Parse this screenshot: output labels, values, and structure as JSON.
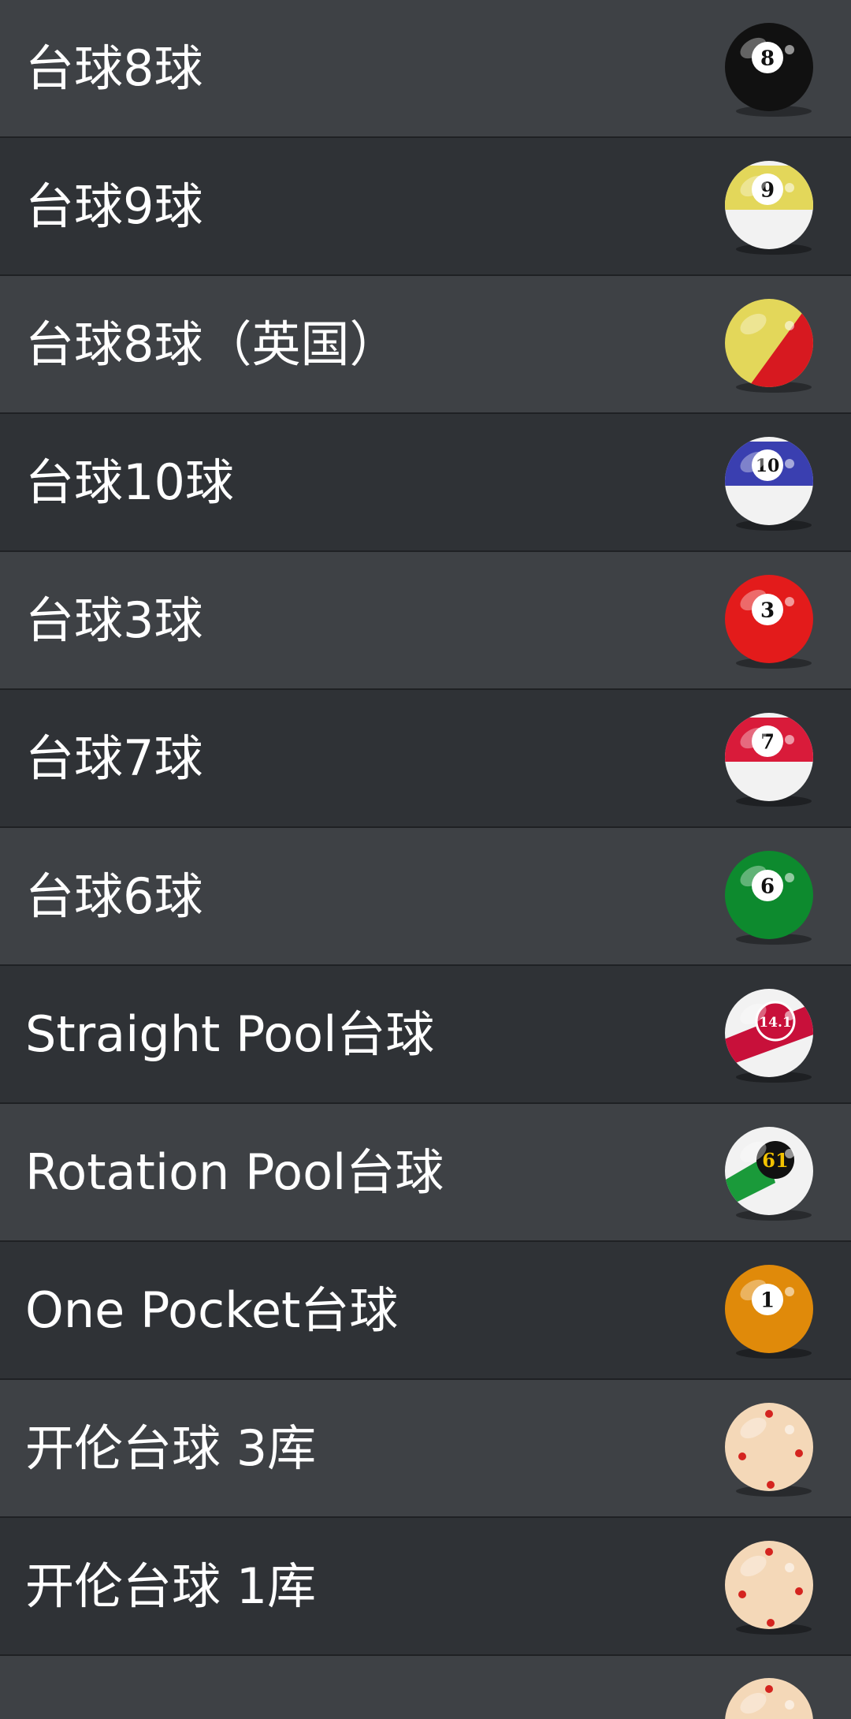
{
  "game_list": {
    "items": [
      {
        "label": "台球8球",
        "icon": "eight-ball-icon",
        "kind": "solid",
        "color": "#111111",
        "num": "8"
      },
      {
        "label": "台球9球",
        "icon": "nine-ball-icon",
        "kind": "stripe",
        "color": "#e3d75a",
        "num": "9"
      },
      {
        "label": "台球8球（英国）",
        "icon": "uk-eight-ball-icon",
        "kind": "split",
        "color": "#e3d75a",
        "color2": "#d71920",
        "num": ""
      },
      {
        "label": "台球10球",
        "icon": "ten-ball-icon",
        "kind": "stripe",
        "color": "#3a3fb0",
        "num": "10"
      },
      {
        "label": "台球3球",
        "icon": "three-ball-icon",
        "kind": "solid",
        "color": "#e31b1b",
        "num": "3"
      },
      {
        "label": "台球7球",
        "icon": "seven-ball-icon",
        "kind": "stripe",
        "color": "#d91b3a",
        "num": "7"
      },
      {
        "label": "台球6球",
        "icon": "six-ball-icon",
        "kind": "solid",
        "color": "#0d8a2e",
        "num": "6"
      },
      {
        "label": "Straight Pool台球",
        "icon": "straight-pool-ball-icon",
        "kind": "band",
        "color": "#c8103a",
        "num": "14.1"
      },
      {
        "label": "Rotation Pool台球",
        "icon": "rotation-pool-ball-icon",
        "kind": "rotation",
        "color": "#1a9a3a",
        "num": "61"
      },
      {
        "label": "One Pocket台球",
        "icon": "one-pocket-ball-icon",
        "kind": "solid",
        "color": "#e08a0a",
        "num": "1"
      },
      {
        "label": "开伦台球 3库",
        "icon": "carom-three-cushion-ball-icon",
        "kind": "carom",
        "color": "#f4d8b8",
        "num": ""
      },
      {
        "label": "开伦台球 1库",
        "icon": "carom-one-cushion-ball-icon",
        "kind": "carom",
        "color": "#f4d8b8",
        "num": ""
      },
      {
        "label": "",
        "icon": "carom-ball-icon",
        "kind": "carom",
        "color": "#f4d8b8",
        "num": ""
      }
    ]
  },
  "colors": {
    "row_light": "#3e4145",
    "row_dark": "#2f3236",
    "divider": "#1f2124",
    "text": "#ffffff"
  }
}
